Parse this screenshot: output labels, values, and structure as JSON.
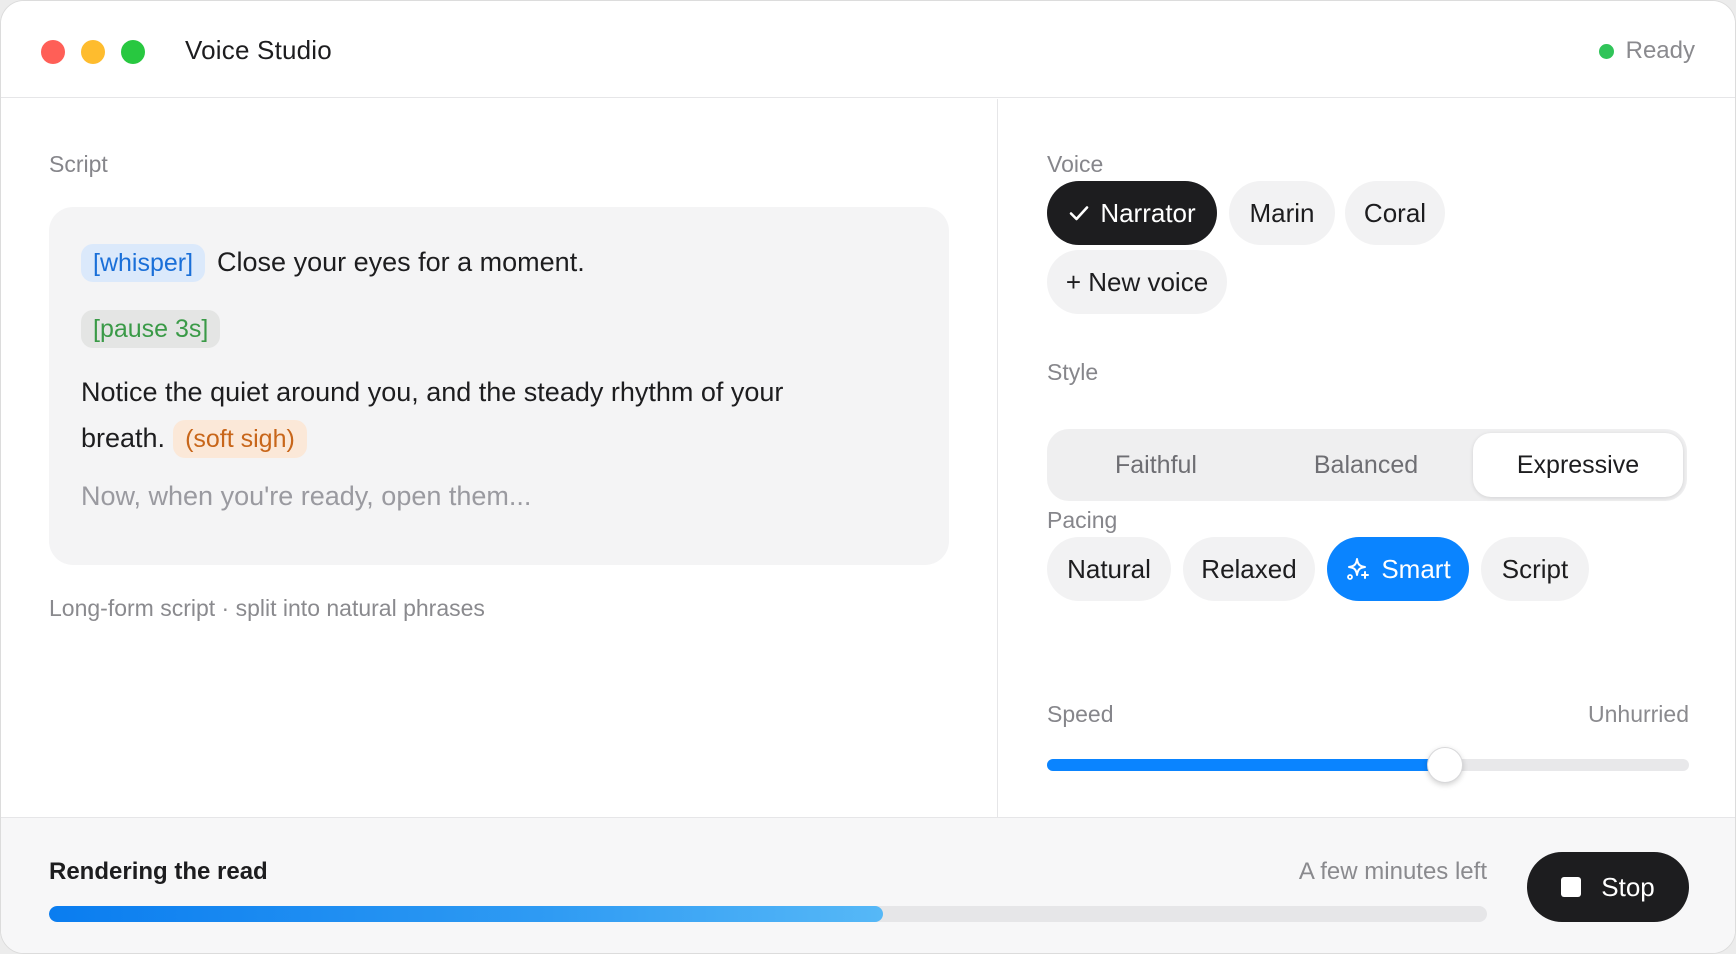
{
  "window": {
    "title": "Voice Studio",
    "status": "Ready",
    "status_color": "#30c459"
  },
  "script": {
    "label": "Script",
    "lines": [
      {
        "tag": "[whisper]",
        "text": "Close your eyes for a moment."
      },
      {
        "tag": "[pause 3s]"
      },
      {
        "text_a": "Notice the quiet around you, and the steady rhythm of your",
        "text_b": "breath.",
        "tag": "(soft sigh)"
      },
      {
        "text": "Now, when you're ready, open them..."
      }
    ],
    "caption": "Long-form script · split into natural phrases"
  },
  "voice": {
    "label": "Voice",
    "options": [
      {
        "label": "Narrator",
        "selected": true,
        "icon": "check-icon"
      },
      {
        "label": "Marin"
      },
      {
        "label": "Coral"
      }
    ],
    "new_voice": "+ New voice"
  },
  "style": {
    "label": "Style",
    "options": [
      "Faithful",
      "Balanced",
      "Expressive"
    ],
    "selected": "Expressive"
  },
  "pacing": {
    "label": "Pacing",
    "options": [
      {
        "label": "Natural"
      },
      {
        "label": "Relaxed"
      },
      {
        "label": "Smart",
        "selected": true,
        "icon": "sparkle-icon"
      },
      {
        "label": "Script"
      }
    ]
  },
  "speed": {
    "label": "Speed",
    "value_label": "Unhurried",
    "level": 0.62
  },
  "render": {
    "title": "Rendering the read",
    "eta": "A few minutes left",
    "progress": 0.58,
    "stop_label": "Stop"
  },
  "colors": {
    "accent": "#0a84ff",
    "dark": "#1d1d1f"
  }
}
